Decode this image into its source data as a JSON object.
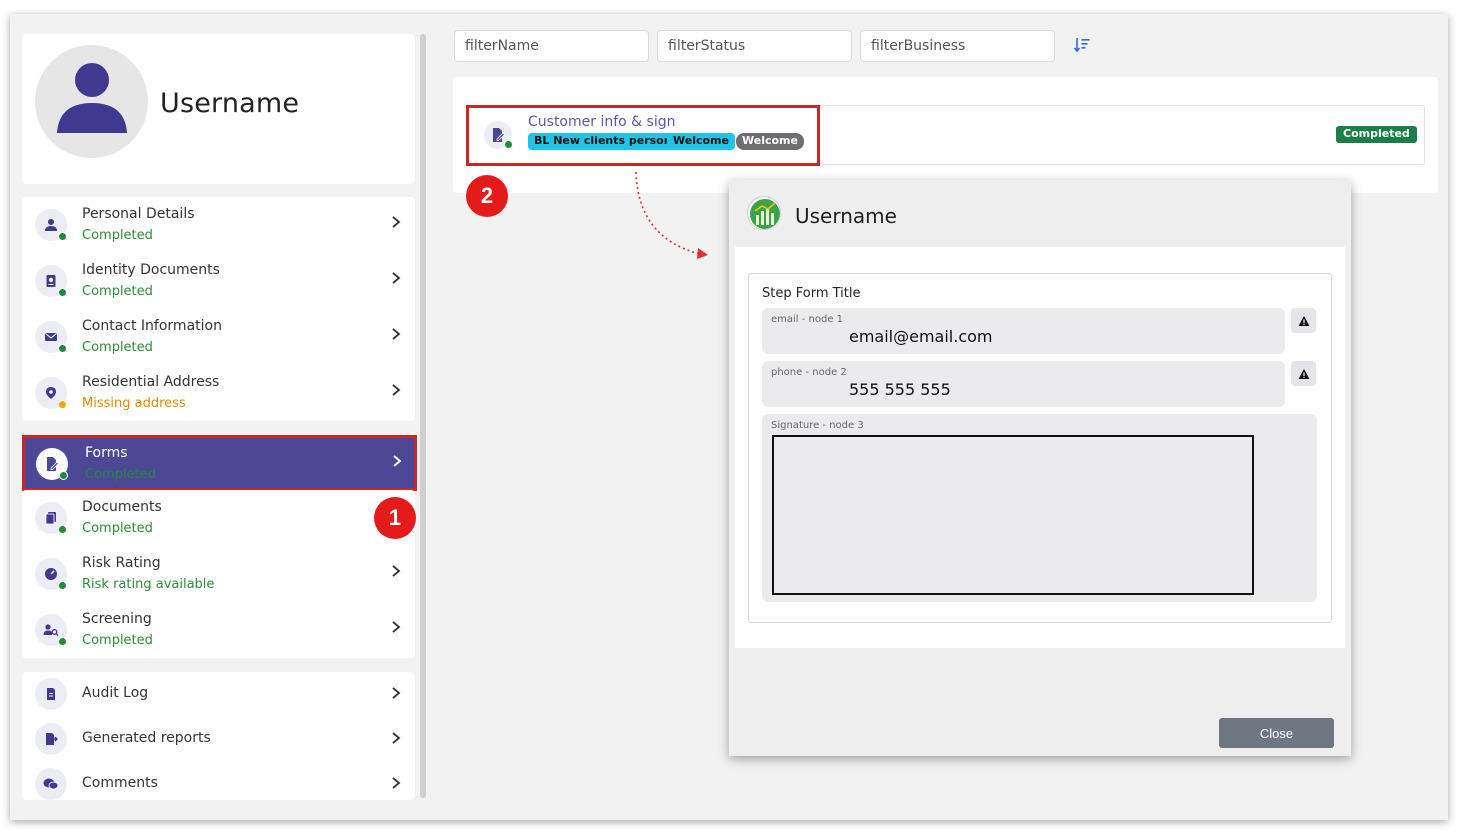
{
  "profile": {
    "username": "Username"
  },
  "nav_group_1": [
    {
      "title": "Personal Details",
      "status": "Completed",
      "icon": "person-icon",
      "status_color": "green"
    },
    {
      "title": "Identity Documents",
      "status": "Completed",
      "icon": "passport-icon",
      "status_color": "green"
    },
    {
      "title": "Contact Information",
      "status": "Completed",
      "icon": "envelope-icon",
      "status_color": "green"
    },
    {
      "title": "Residential Address",
      "status": "Missing address",
      "icon": "location-pin-icon",
      "status_color": "orange"
    }
  ],
  "forms_item": {
    "title": "Forms",
    "status": "Completed",
    "icon": "form-edit-icon"
  },
  "nav_group_2": [
    {
      "title": "Documents",
      "status": "Completed",
      "icon": "documents-icon"
    },
    {
      "title": "Risk Rating",
      "status": "Risk rating available",
      "icon": "risk-gauge-icon"
    },
    {
      "title": "Screening",
      "status": "Completed",
      "icon": "screening-icon"
    }
  ],
  "nav_group_3": [
    {
      "title": "Audit Log",
      "icon": "audit-log-icon"
    },
    {
      "title": "Generated reports",
      "icon": "report-export-icon"
    },
    {
      "title": "Comments",
      "icon": "comments-icon"
    }
  ],
  "callouts": {
    "one": "1",
    "two": "2"
  },
  "filters": {
    "name": "filterName",
    "status": "filterStatus",
    "business": "filterBusiness"
  },
  "form_row": {
    "title": "Customer info & sign",
    "tags": [
      "BL New clients person",
      "Welcome",
      "Welcome"
    ],
    "status": "Completed"
  },
  "modal": {
    "title": "Username",
    "step_title": "Step Form Title",
    "fields": [
      {
        "label": "email - node 1",
        "value": "email@email.com"
      },
      {
        "label": "phone - node 2",
        "value": "555 555 555"
      }
    ],
    "signature_label": "Signature - node 3",
    "close_label": "Close"
  },
  "colors": {
    "accent": "#4c4896",
    "highlight": "#c62828",
    "completed": "#1a7f46",
    "tag_cyan": "#1fc4e8",
    "warning": "#e08a00"
  }
}
